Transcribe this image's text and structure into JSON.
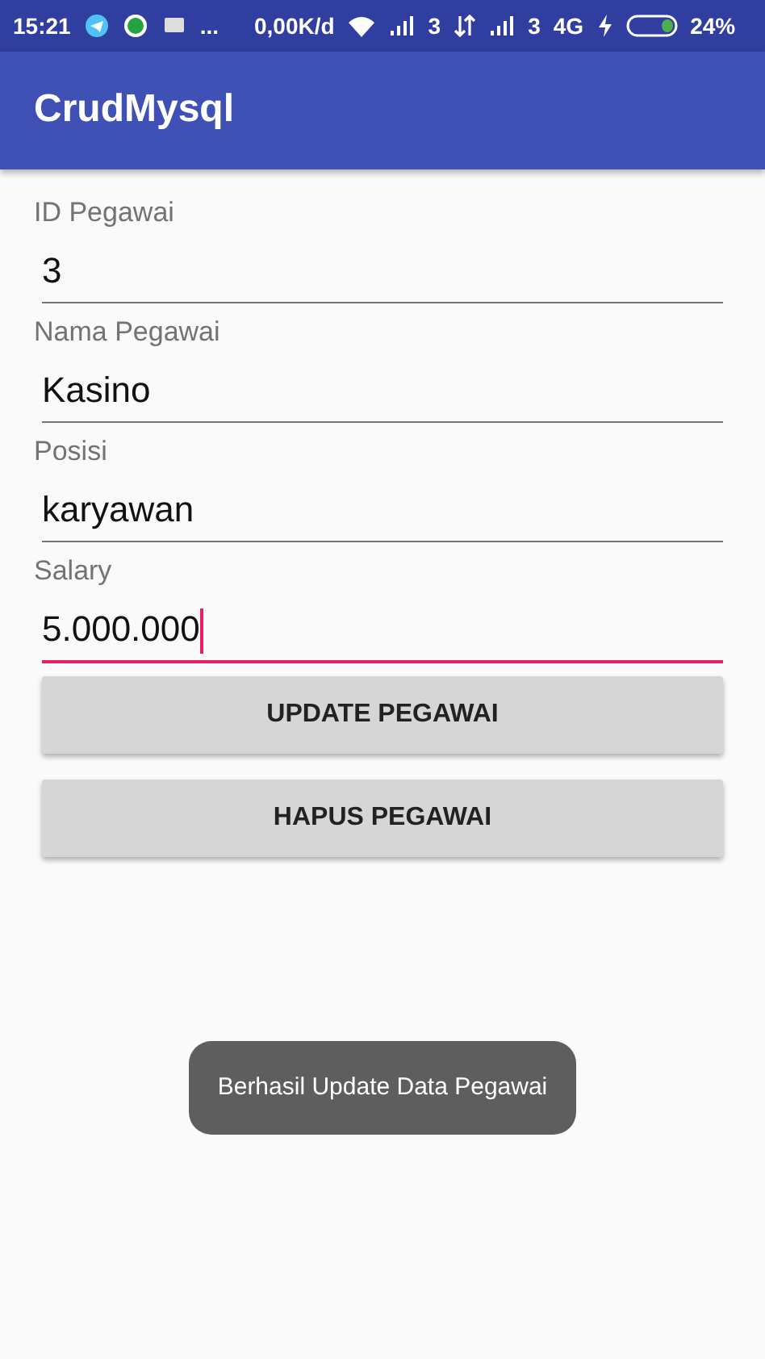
{
  "status_bar": {
    "time": "15:21",
    "more": "...",
    "speed": "0,00K/d",
    "sim_1": "3",
    "sim_2": "3",
    "network": "4G",
    "battery": "24%"
  },
  "app_bar": {
    "title": "CrudMysql"
  },
  "fields": [
    {
      "label": "ID Pegawai",
      "value": "3",
      "focused": false
    },
    {
      "label": "Nama Pegawai",
      "value": "Kasino",
      "focused": false
    },
    {
      "label": "Posisi",
      "value": "karyawan",
      "focused": false
    },
    {
      "label": "Salary",
      "value": "5.000.000",
      "focused": true
    }
  ],
  "buttons": [
    "UPDATE PEGAWAI",
    "HAPUS PEGAWAI"
  ],
  "toast": "Berhasil Update Data Pegawai"
}
